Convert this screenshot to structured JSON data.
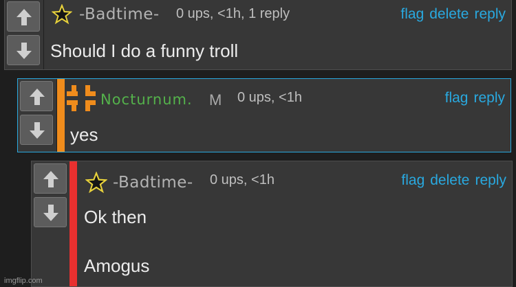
{
  "comments": [
    {
      "username": "-Badtime-",
      "meta": "0 ups, <1h, 1 reply",
      "actions": [
        "flag",
        "delete",
        "reply"
      ],
      "lines": [
        "Should I do a funny troll"
      ],
      "user_icon": "star-icon"
    },
    {
      "username": "Nocturnum.",
      "badge": "M",
      "meta": "0 ups, <1h",
      "actions": [
        "flag",
        "reply"
      ],
      "lines": [
        "yes"
      ],
      "user_icon": "plus-grid-icon",
      "bar_color": "#f08c1c"
    },
    {
      "username": "-Badtime-",
      "meta": "0 ups, <1h",
      "actions": [
        "flag",
        "delete",
        "reply"
      ],
      "lines": [
        "Ok then",
        "Amogus"
      ],
      "user_icon": "star-icon",
      "bar_color": "#e8302f"
    }
  ],
  "watermark": "imgflip.com",
  "colors": {
    "link": "#29a9e0",
    "highlight_border": "#29a9e0",
    "mod_name": "#54b24b"
  }
}
